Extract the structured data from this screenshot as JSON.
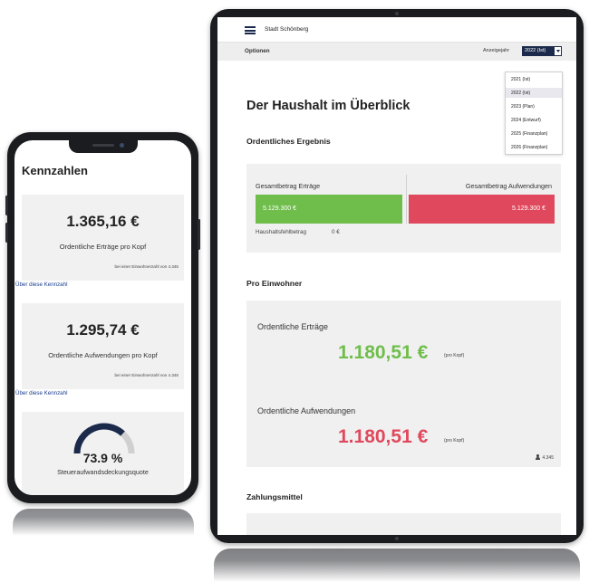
{
  "phone": {
    "title": "Kennzahlen",
    "cards": [
      {
        "value": "1.365,16 €",
        "label": "Ordentliche Erträge pro Kopf",
        "note": "bei einer Einwohnerzahl von 4.345",
        "link": "Über diese Kennzahl"
      },
      {
        "value": "1.295,74 €",
        "label": "Ordentliche Aufwendungen pro Kopf",
        "note": "bei einer Einwohnerzahl von 4.345",
        "link": "Über diese Kennzahl"
      }
    ],
    "gauge": {
      "value_text": "73.9 %",
      "fraction": 0.739,
      "label": "Steueraufwandsdeckungsquote",
      "fill_color": "#1b2a4a",
      "track_color": "#d0d0d0"
    }
  },
  "tablet": {
    "app_title": "Stadt Schönberg",
    "options_label": "Optionen",
    "year_label": "Anzeigejahr",
    "year_selected": "2022 (Ist)",
    "year_options": [
      "2021 (Ist)",
      "2022 (Ist)",
      "2023 (Plan)",
      "2024 (Entwurf)",
      "2025 (Finanzplan)",
      "2026 (Finanzplan)"
    ],
    "heading": "Der Haushalt im Überblick",
    "ordentliches_ergebnis": {
      "heading": "Ordentliches Ergebnis",
      "ertraege_label": "Gesamtbetrag Erträge",
      "ertraege_value": "5.129.300 €",
      "aufwendungen_label": "Gesamtbetrag Aufwendungen",
      "aufwendungen_value": "5.129.300 €",
      "fehlbetrag_label": "Haushaltsfehlbetrag",
      "fehlbetrag_value": "0 €"
    },
    "pro_einwohner": {
      "heading": "Pro Einwohner",
      "ertraege_label": "Ordentliche Erträge",
      "ertraege_value": "1.180,51 €",
      "aufwendungen_label": "Ordentliche Aufwendungen",
      "aufwendungen_value": "1.180,51 €",
      "unit": "(pro Kopf)",
      "population": "4.345"
    },
    "zahlungsmittel_heading": "Zahlungsmittel"
  },
  "colors": {
    "green": "#6fbe4b",
    "red": "#e0495d",
    "navy": "#1b2a4a"
  }
}
